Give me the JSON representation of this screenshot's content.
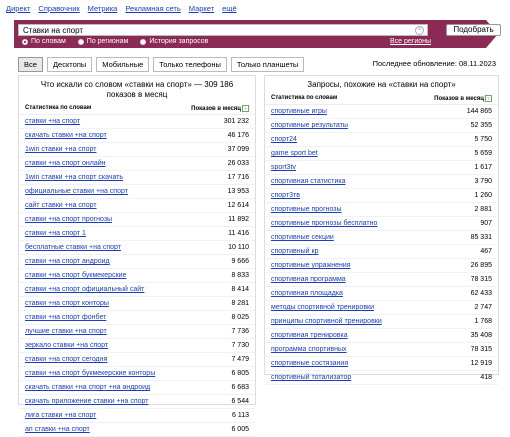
{
  "topnav": [
    "Директ",
    "Справочник",
    "Метрика",
    "Рекламная сеть",
    "Маркет",
    "ещё"
  ],
  "search": {
    "value": "Ставки на спорт",
    "button": "Подобрать",
    "modes": [
      "По словам",
      "По регионам",
      "История запросов"
    ],
    "all_regions": "Все регионы"
  },
  "tabs": [
    "Все",
    "Десктопы",
    "Мобильные",
    "Только телефоны",
    "Только планшеты"
  ],
  "updated": "Последнее обновление: 08.11.2023",
  "left": {
    "title_l1": "Что искали со словом «ставки на спорт» — 309 186",
    "title_l2": "показов в месяц",
    "col1": "Статистика по словам",
    "col2": "Показов в месяц",
    "rows": [
      [
        "ставки +на спорт",
        "301 232"
      ],
      [
        "скачать ставки +на спорт",
        "46 176"
      ],
      [
        "1win ставки +на спорт",
        "37 099"
      ],
      [
        "ставки +на спорт онлайн",
        "26 033"
      ],
      [
        "1win ставки +на спорт скачать",
        "17 716"
      ],
      [
        "официальные ставки +на спорт",
        "13 953"
      ],
      [
        "сайт ставки +на спорт",
        "12 614"
      ],
      [
        "ставки +на спорт прогнозы",
        "11 892"
      ],
      [
        "ставки +на спорт 1",
        "11 416"
      ],
      [
        "бесплатные ставки +на спорт",
        "10 110"
      ],
      [
        "ставки +на спорт андроид",
        "9 666"
      ],
      [
        "ставки +на спорт букмекерские",
        "8 833"
      ],
      [
        "ставки +на спорт официальный сайт",
        "8 414"
      ],
      [
        "ставки +на спорт конторы",
        "8 281"
      ],
      [
        "ставки +на спорт фонбет",
        "8 025"
      ],
      [
        "лучшие ставки +на спорт",
        "7 736"
      ],
      [
        "зеркало ставки +на спорт",
        "7 730"
      ],
      [
        "ставки +на спорт сегодня",
        "7 479"
      ],
      [
        "ставки +на спорт букмекерские конторы",
        "6 805"
      ],
      [
        "скачать ставки +на спорт +на андроид",
        "6 683"
      ],
      [
        "скачать приложение ставки +на спорт",
        "6 544"
      ],
      [
        "лига ставки +на спорт",
        "6 113"
      ],
      [
        "ап ставки +на спорт",
        "6 005"
      ]
    ]
  },
  "right": {
    "title": "Запросы, похожие на «ставки на спорт»",
    "col1": "Статистика по словам",
    "col2": "Показов в месяц",
    "rows": [
      [
        "спортивные игры",
        "144 865"
      ],
      [
        "спортивные результаты",
        "52 355"
      ],
      [
        "спорт24",
        "5 750"
      ],
      [
        "game sport bet",
        "5 659"
      ],
      [
        "sport3tv",
        "1 617"
      ],
      [
        "спортивная статистика",
        "3 790"
      ],
      [
        "спорт3тв",
        "1 260"
      ],
      [
        "спортивные прогнозы",
        "2 881"
      ],
      [
        "спортивные прогнозы бесплатно",
        "907"
      ],
      [
        "спортивные секции",
        "85 331"
      ],
      [
        "спортивный кр",
        "467"
      ],
      [
        "спортивные упражнения",
        "26 895"
      ],
      [
        "спортивная программа",
        "78 315"
      ],
      [
        "спортивная площадка",
        "62 433"
      ],
      [
        "методы спортивной тренировки",
        "2 747"
      ],
      [
        "принципы спортивной тренировки",
        "1 768"
      ],
      [
        "спортивная тренировка",
        "35 408"
      ],
      [
        "программа спортивных",
        "78 315"
      ],
      [
        "спортивные состязания",
        "12 919"
      ],
      [
        "спортивный тотализатор",
        "418"
      ]
    ]
  }
}
